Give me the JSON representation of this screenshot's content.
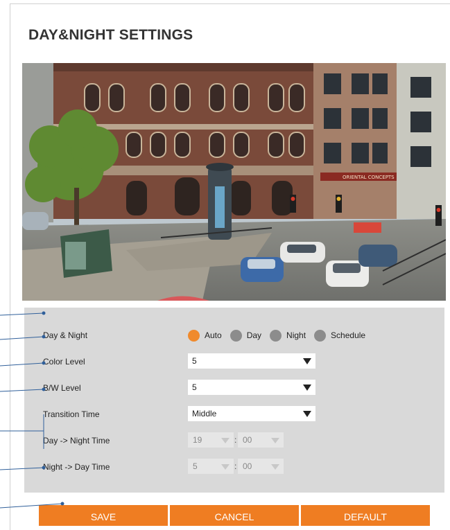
{
  "page": {
    "title": "DAY&NIGHT SETTINGS"
  },
  "camera": {
    "signs": {
      "shop": "ORIENTAL CONCEPTS"
    }
  },
  "settings": {
    "day_night": {
      "label": "Day & Night",
      "options": [
        "Auto",
        "Day",
        "Night",
        "Schedule"
      ],
      "selected": "Auto"
    },
    "color_level": {
      "label": "Color Level",
      "value": "5"
    },
    "bw_level": {
      "label": "B/W Level",
      "value": "5"
    },
    "transition_time": {
      "label": "Transition Time",
      "value": "Middle"
    },
    "day_to_night": {
      "label": "Day -> Night Time",
      "hour": "19",
      "minute": "00"
    },
    "night_to_day": {
      "label": "Night -> Day Time",
      "hour": "5",
      "minute": "00"
    }
  },
  "actions": {
    "save": "SAVE",
    "cancel": "CANCEL",
    "default": "DEFAULT"
  },
  "colors": {
    "accent": "#ef7d22",
    "radio_on": "#f08a2c",
    "radio_off": "#8c8c8c",
    "panel": "#d9d9d9",
    "callout": "#2f5f9a"
  }
}
